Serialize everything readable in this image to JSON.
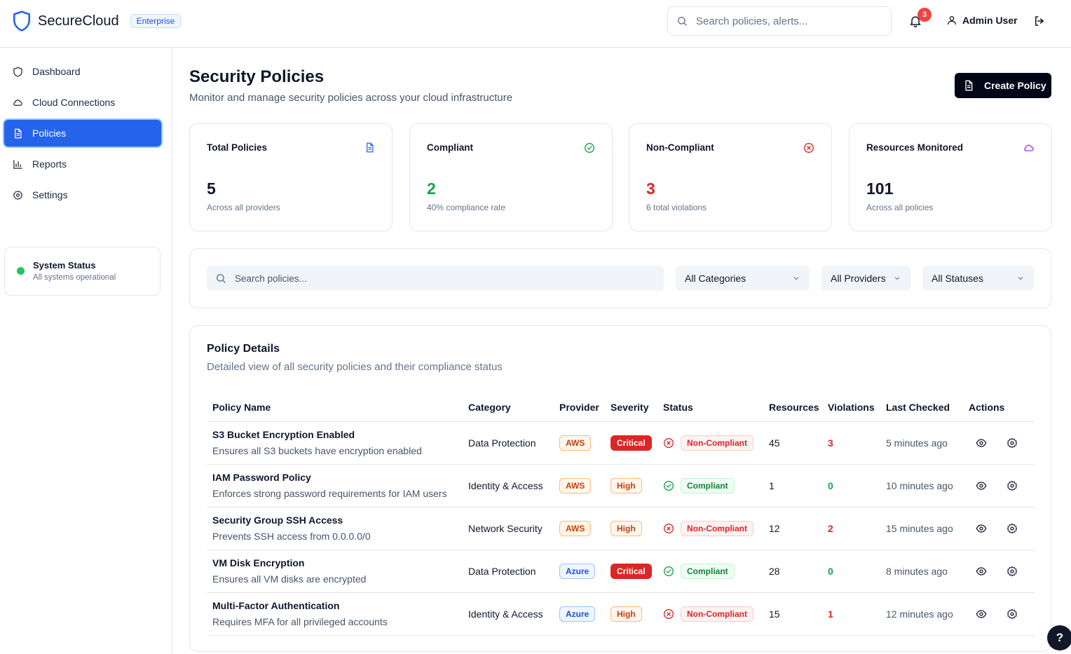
{
  "brand": {
    "name": "SecureCloud",
    "badge": "Enterprise"
  },
  "header": {
    "search_placeholder": "Search policies, alerts...",
    "notification_count": "3",
    "user_name": "Admin User"
  },
  "sidebar": {
    "items": [
      {
        "label": "Dashboard",
        "icon": "shield-icon"
      },
      {
        "label": "Cloud Connections",
        "icon": "cloud-icon"
      },
      {
        "label": "Policies",
        "icon": "document-icon",
        "active": true
      },
      {
        "label": "Reports",
        "icon": "bar-chart-icon"
      },
      {
        "label": "Settings",
        "icon": "gear-icon"
      }
    ],
    "status": {
      "title": "System Status",
      "subtitle": "All systems operational",
      "color": "#22c55e"
    }
  },
  "main": {
    "title": "Security Policies",
    "subtitle": "Monitor and manage security policies across your cloud infrastructure",
    "create_label": "Create Policy"
  },
  "stats": [
    {
      "label": "Total Policies",
      "value": "5",
      "sub": "Across all providers",
      "color": "#0f172a",
      "icon": "document-icon",
      "icon_color": "#2563eb"
    },
    {
      "label": "Compliant",
      "value": "2",
      "sub": "40% compliance rate",
      "color": "#16a34a",
      "icon": "check-circle-icon",
      "icon_color": "#16a34a"
    },
    {
      "label": "Non-Compliant",
      "value": "3",
      "sub": "6 total violations",
      "color": "#dc2626",
      "icon": "x-circle-icon",
      "icon_color": "#dc2626"
    },
    {
      "label": "Resources Monitored",
      "value": "101",
      "sub": "Across all policies",
      "color": "#0f172a",
      "icon": "cloud-icon",
      "icon_color": "#9333ea"
    }
  ],
  "filters": {
    "search_placeholder": "Search policies...",
    "category": "All Categories",
    "provider": "All Providers",
    "status": "All Statuses"
  },
  "details": {
    "title": "Policy Details",
    "subtitle": "Detailed view of all security policies and their compliance status",
    "columns": [
      "Policy Name",
      "Category",
      "Provider",
      "Severity",
      "Status",
      "Resources",
      "Violations",
      "Last Checked",
      "Actions"
    ],
    "rows": [
      {
        "name": "S3 Bucket Encryption Enabled",
        "desc": "Ensures all S3 buckets have encryption enabled",
        "category": "Data Protection",
        "provider": "AWS",
        "severity": "Critical",
        "status": "Non-Compliant",
        "resources": "45",
        "violations": "3",
        "last_checked": "5 minutes ago"
      },
      {
        "name": "IAM Password Policy",
        "desc": "Enforces strong password requirements for IAM users",
        "category": "Identity & Access",
        "provider": "AWS",
        "severity": "High",
        "status": "Compliant",
        "resources": "1",
        "violations": "0",
        "last_checked": "10 minutes ago"
      },
      {
        "name": "Security Group SSH Access",
        "desc": "Prevents SSH access from 0.0.0.0/0",
        "category": "Network Security",
        "provider": "AWS",
        "severity": "High",
        "status": "Non-Compliant",
        "resources": "12",
        "violations": "2",
        "last_checked": "15 minutes ago"
      },
      {
        "name": "VM Disk Encryption",
        "desc": "Ensures all VM disks are encrypted",
        "category": "Data Protection",
        "provider": "Azure",
        "severity": "Critical",
        "status": "Compliant",
        "resources": "28",
        "violations": "0",
        "last_checked": "8 minutes ago"
      },
      {
        "name": "Multi-Factor Authentication",
        "desc": "Requires MFA for all privileged accounts",
        "category": "Identity & Access",
        "provider": "Azure",
        "severity": "High",
        "status": "Non-Compliant",
        "resources": "15",
        "violations": "1",
        "last_checked": "12 minutes ago"
      }
    ]
  },
  "help_label": "?"
}
